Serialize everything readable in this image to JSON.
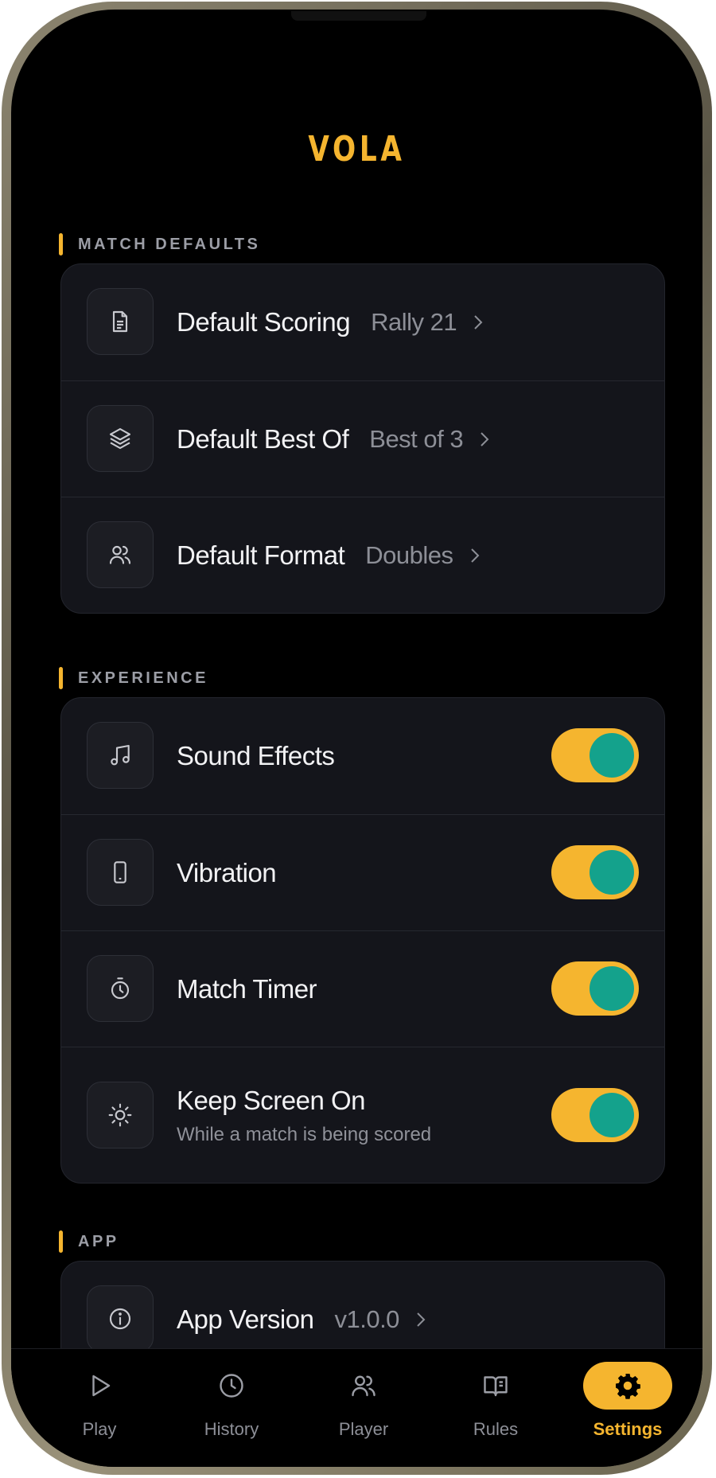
{
  "app": {
    "title": "VOLA"
  },
  "sections": {
    "match_defaults": {
      "label": "MATCH DEFAULTS",
      "rows": [
        {
          "title": "Default Scoring",
          "value": "Rally 21",
          "icon": "document-icon"
        },
        {
          "title": "Default Best Of",
          "value": "Best of 3",
          "icon": "layers-icon"
        },
        {
          "title": "Default Format",
          "value": "Doubles",
          "icon": "users-icon"
        }
      ]
    },
    "experience": {
      "label": "EXPERIENCE",
      "rows": [
        {
          "title": "Sound Effects",
          "icon": "music-note-icon",
          "enabled": true
        },
        {
          "title": "Vibration",
          "icon": "phone-icon",
          "enabled": true
        },
        {
          "title": "Match Timer",
          "icon": "stopwatch-icon",
          "enabled": true
        },
        {
          "title": "Keep Screen On",
          "subtitle": "While a match is being scored",
          "icon": "sun-icon",
          "enabled": true
        }
      ]
    },
    "app": {
      "label": "APP",
      "rows": [
        {
          "title": "App Version",
          "value": "v1.0.0",
          "icon": "info-icon"
        }
      ]
    }
  },
  "tabbar": {
    "active": "Settings",
    "tabs": [
      {
        "label": "Play",
        "icon": "play-icon"
      },
      {
        "label": "History",
        "icon": "clock-icon"
      },
      {
        "label": "Player",
        "icon": "users-icon"
      },
      {
        "label": "Rules",
        "icon": "book-icon"
      },
      {
        "label": "Settings",
        "icon": "gear-icon"
      }
    ]
  },
  "colors": {
    "accent": "#f5b52f",
    "toggle_knob": "#14a28c",
    "card_bg": "#14151b",
    "screen_bg": "#000000"
  }
}
